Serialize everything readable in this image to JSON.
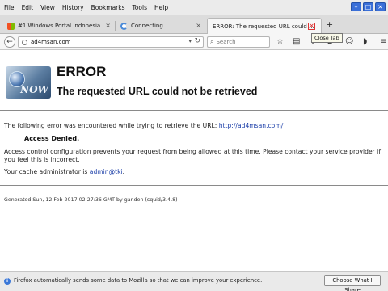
{
  "menu": {
    "file": "File",
    "edit": "Edit",
    "view": "View",
    "history": "History",
    "bookmarks": "Bookmarks",
    "tools": "Tools",
    "help": "Help"
  },
  "tabs": [
    {
      "label": "#1 Windows Portal Indonesia",
      "close": "×"
    },
    {
      "label": "Connecting...",
      "close": "×"
    },
    {
      "label": "ERROR: The requested URL could ...",
      "close": "×"
    }
  ],
  "new_tab": "+",
  "tooltip": "Close Tab",
  "nav": {
    "url": "ad4msan.com",
    "search_placeholder": "Search"
  },
  "page": {
    "logo_text": "NOW",
    "heading": "ERROR",
    "subheading": "The requested URL could not be retrieved",
    "intro_text": "The following error was encountered while trying to retrieve the URL:",
    "intro_link": "http://ad4msan.com/",
    "denied": "Access Denied.",
    "policy_line1": "Access control configuration prevents your request from being allowed at this time. Please contact your service provider if",
    "policy_line2": "you feel this is incorrect.",
    "admin_text": "Your cache administrator is",
    "admin_link": "admin@tki",
    "admin_suffix": ".",
    "generated": "Generated Sun, 12 Feb 2017 02:27:36 GMT by ganden (squid/3.4.8)"
  },
  "notification": {
    "message": "Firefox automatically sends some data to Mozilla so that we can improve your experience.",
    "button": "Choose What I Share"
  }
}
